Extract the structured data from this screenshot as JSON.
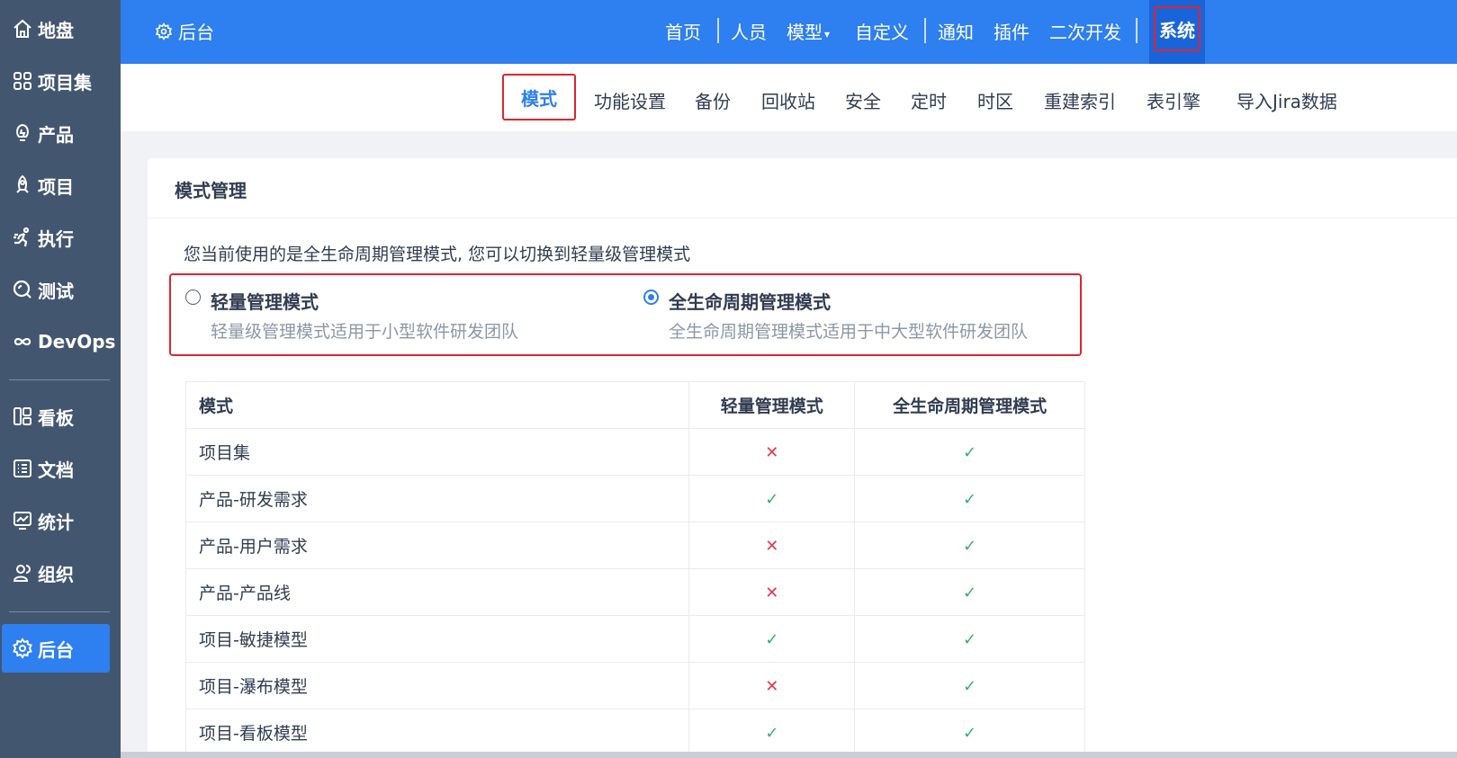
{
  "sidebar": {
    "items": [
      {
        "label": "地盘",
        "icon": "home-icon"
      },
      {
        "label": "项目集",
        "icon": "grid-icon"
      },
      {
        "label": "产品",
        "icon": "bulb-icon"
      },
      {
        "label": "项目",
        "icon": "rocket-icon"
      },
      {
        "label": "执行",
        "icon": "run-icon"
      },
      {
        "label": "测试",
        "icon": "search-bug-icon"
      },
      {
        "label": "DevOps",
        "icon": "infinity-icon"
      },
      {
        "label": "看板",
        "icon": "kanban-icon"
      },
      {
        "label": "文档",
        "icon": "doc-list-icon"
      },
      {
        "label": "统计",
        "icon": "chart-monitor-icon"
      },
      {
        "label": "组织",
        "icon": "people-icon"
      },
      {
        "label": "后台",
        "icon": "gear-icon"
      }
    ]
  },
  "header": {
    "brand": "后台",
    "nav": [
      "首页",
      "人员",
      "模型",
      "自定义",
      "通知",
      "插件",
      "二次开发"
    ],
    "active": "系统",
    "colors": {
      "primary": "#2e7ff0",
      "highlight": "#e0242e"
    }
  },
  "subnav": {
    "active": "模式",
    "items": [
      "功能设置",
      "备份",
      "回收站",
      "安全",
      "定时",
      "时区",
      "重建索引",
      "表引擎",
      "导入Jira数据"
    ]
  },
  "panel": {
    "title": "模式管理",
    "intro": "您当前使用的是全生命周期管理模式, 您可以切换到轻量级管理模式",
    "modes": [
      {
        "name": "轻量管理模式",
        "desc": "轻量级管理模式适用于小型软件研发团队",
        "selected": false
      },
      {
        "name": "全生命周期管理模式",
        "desc": "全生命周期管理模式适用于中大型软件研发团队",
        "selected": true
      }
    ],
    "table": {
      "headers": [
        "模式",
        "轻量管理模式",
        "全生命周期管理模式"
      ],
      "rows": [
        {
          "name": "项目集",
          "light": "✕",
          "full": "✓"
        },
        {
          "name": "产品-研发需求",
          "light": "✓",
          "full": "✓"
        },
        {
          "name": "产品-用户需求",
          "light": "✕",
          "full": "✓"
        },
        {
          "name": "产品-产品线",
          "light": "✕",
          "full": "✓"
        },
        {
          "name": "项目-敏捷模型",
          "light": "✓",
          "full": "✓"
        },
        {
          "name": "项目-瀑布模型",
          "light": "✕",
          "full": "✓"
        },
        {
          "name": "项目-看板模型",
          "light": "✓",
          "full": "✓"
        }
      ]
    }
  }
}
